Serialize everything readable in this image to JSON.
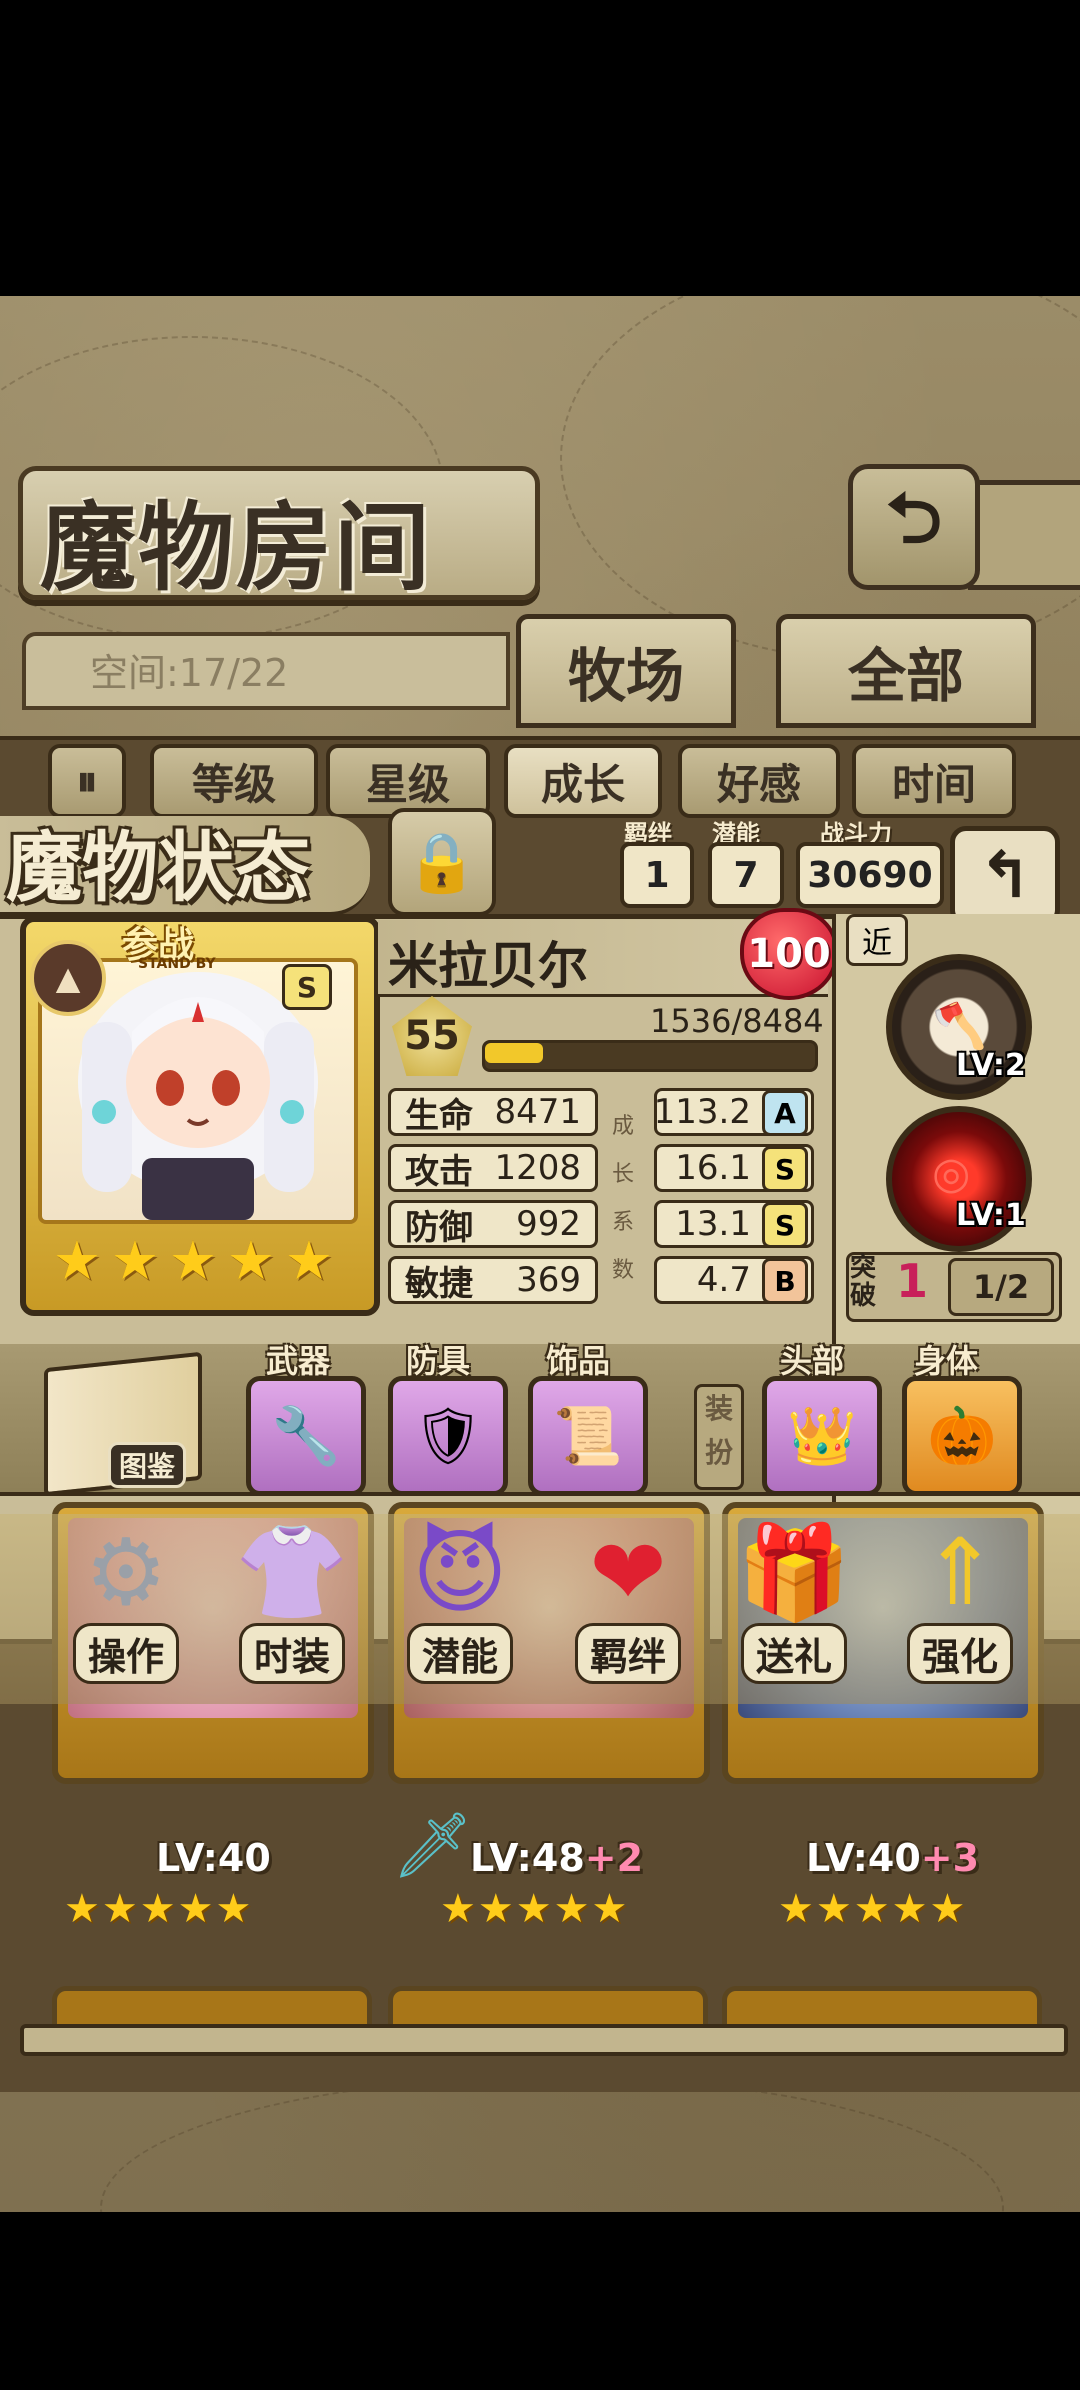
{
  "header": {
    "title": "魔物房间",
    "back_icon": "return-arrow-icon"
  },
  "space": {
    "label": "空间:17/22"
  },
  "tabs": [
    {
      "label": "牧场"
    },
    {
      "label": "全部"
    }
  ],
  "filters": [
    {
      "icon": "pause-icon"
    },
    {
      "label": "等级"
    },
    {
      "label": "星级"
    },
    {
      "label": "成长",
      "active": true
    },
    {
      "label": "好感"
    },
    {
      "label": "时间"
    }
  ],
  "status": {
    "title": "魔物状态",
    "bond_label": "羁绊",
    "bond_value": "1",
    "potential_label": "潜能",
    "potential_value": "7",
    "power_label": "战斗力",
    "power_value": "30690"
  },
  "monster": {
    "standby_label": "参战",
    "standby_sub": "STAND BY",
    "rank": "S",
    "stars": 5,
    "name": "米拉贝尔",
    "affection": "100",
    "level": "55",
    "xp_text": "1536/8484",
    "xp_fraction": 0.18,
    "stats": [
      {
        "label": "生命",
        "value": "8471",
        "growth": "113.2",
        "grade": "A"
      },
      {
        "label": "攻击",
        "value": "1208",
        "growth": "16.1",
        "grade": "S"
      },
      {
        "label": "防御",
        "value": "992",
        "growth": "13.1",
        "grade": "S"
      },
      {
        "label": "敏捷",
        "value": "369",
        "growth": "4.7",
        "grade": "B"
      }
    ],
    "growth_labels": [
      "成",
      "长",
      "系",
      "数"
    ]
  },
  "skills": {
    "range_tag": "近",
    "skill1_lv": "LV:2",
    "skill2_lv": "LV:1",
    "break_label": "突破",
    "break_value": "1",
    "break_progress": "1/2"
  },
  "equipment": {
    "codex_label": "图鉴",
    "weapon_label": "武器",
    "armor_label": "防具",
    "accessory_label": "饰品",
    "dress_label": "装扮",
    "head_label": "头部",
    "body_label": "身体"
  },
  "actions": [
    {
      "label": "操作",
      "icon": "gear-icon"
    },
    {
      "label": "时装",
      "icon": "clothes-icon"
    },
    {
      "label": "潜能",
      "icon": "demon-icon"
    },
    {
      "label": "羁绊",
      "icon": "hearts-icon"
    },
    {
      "label": "送礼",
      "icon": "gift-icon"
    },
    {
      "label": "强化",
      "icon": "upgrade-arrows-icon"
    }
  ],
  "cards": [
    {
      "lv": "LV:40",
      "plus": ""
    },
    {
      "lv": "LV:48",
      "plus": "+2"
    },
    {
      "lv": "LV:40",
      "plus": "+3"
    }
  ]
}
